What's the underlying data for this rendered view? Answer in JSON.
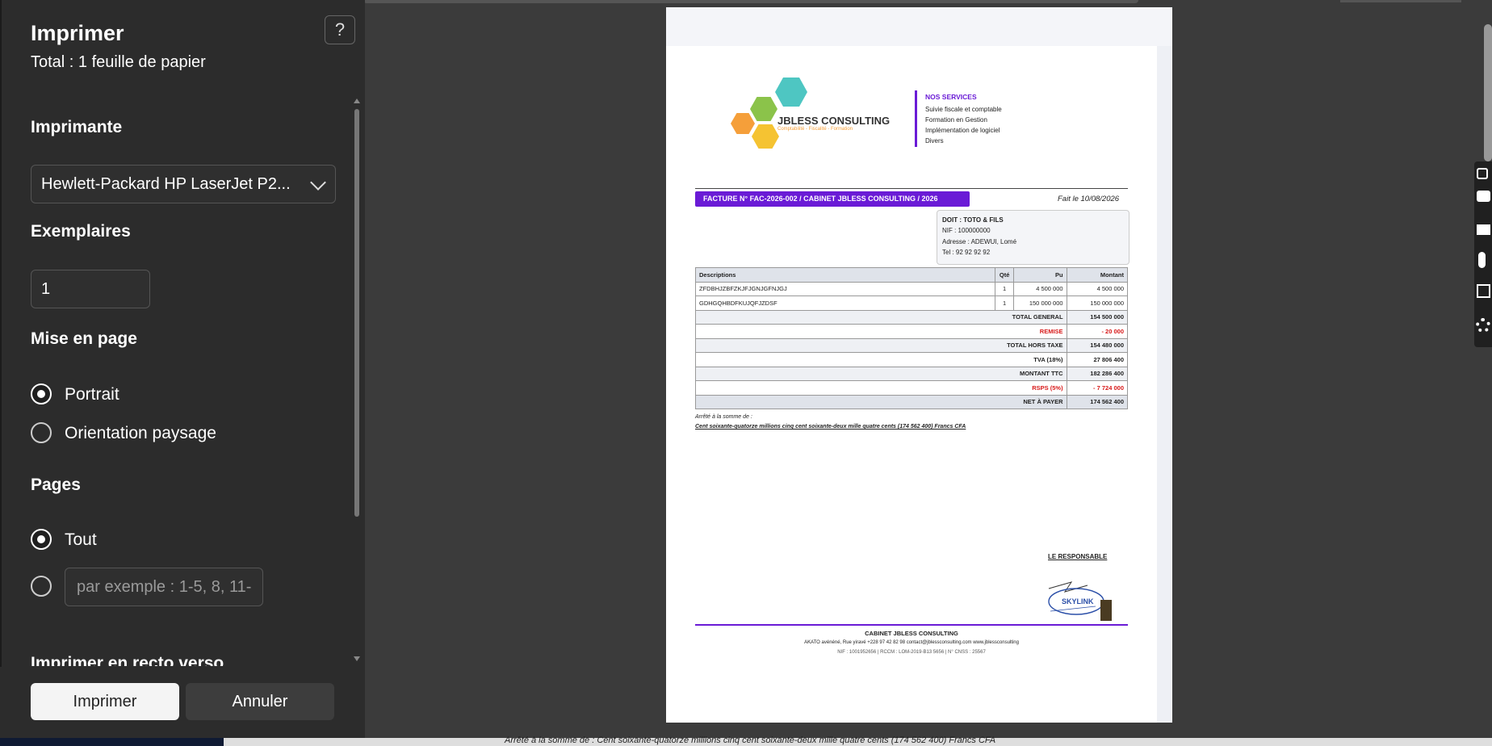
{
  "dialog": {
    "title": "Imprimer",
    "subtitle": "Total : 1 feuille de papier",
    "help_label": "?",
    "printer_label": "Imprimante",
    "printer_value": "Hewlett-Packard HP LaserJet P2...",
    "copies_label": "Exemplaires",
    "copies_value": "1",
    "layout_label": "Mise en page",
    "layout_options": [
      "Portrait",
      "Orientation paysage"
    ],
    "pages_label": "Pages",
    "pages_all": "Tout",
    "pages_placeholder": "par exemple : 1-5, 8, 11-",
    "duplex_label": "Imprimer en recto verso",
    "print_button": "Imprimer",
    "cancel_button": "Annuler"
  },
  "invoice": {
    "company_name": "JBLESS CONSULTING",
    "tagline": "Comptabilité - Fiscalité - Formation",
    "services_title": "NOS SERVICES",
    "services": [
      "Suivie fiscale et comptable",
      "Formation en Gestion",
      "Implémentation de logiciel",
      "Divers"
    ],
    "title": "FACTURE N° FAC-2026-002 / CABINET JBLESS CONSULTING / 2026",
    "date": "Fait le 10/08/2026",
    "client": [
      "DOIT : TOTO & FILS",
      "NIF : 100000000",
      "Adresse : ADEWUI, Lomé",
      "Tel : 92 92 92 92"
    ],
    "headers": [
      "Descriptions",
      "Qté",
      "Pu",
      "Montant"
    ],
    "rows": [
      [
        "ZFDBHJZBFZKJFJGNJGFNJGJ",
        "1",
        "4 500 000",
        "4 500 000"
      ],
      [
        "GDHGQHBDFKUJQFJZDSF",
        "1",
        "150 000 000",
        "150 000 000"
      ]
    ],
    "totals": [
      [
        "TOTAL GENERAL",
        "154 500 000"
      ],
      [
        "REMISE",
        "- 20 000"
      ],
      [
        "TOTAL HORS TAXE",
        "154 480 000"
      ],
      [
        "TVA (18%)",
        "27 806 400"
      ],
      [
        "MONTANT TTC",
        "182 286 400"
      ],
      [
        "RSPS (5%)",
        "- 7 724 000"
      ],
      [
        "NET À PAYER",
        "174 562 400"
      ]
    ],
    "amount_label": "Arrêté à la somme de :",
    "amount_words": "Cent soixante-quatorze millions cinq cent soixante-deux mille quatre cents (174 562 400) Francs CFA",
    "responsible": "LE RESPONSABLE",
    "stamp_text": "SKYLINK",
    "footer_name": "CABINET JBLESS CONSULTING",
    "footer_contact": "AKATO avénéné, Rue yiravé   +228 97 42 82 98   contact@jblessconsulting.com   www.jblessconsulting",
    "footer_ids": "NIF : 1001952656 | RCCM : LOM-2019-B13 5656 | N° CNSS : 25567"
  },
  "bottom_text": "Arrêté à la somme de : Cent soixante-quatorze millions cinq cent soixante-deux mille quatre cents (174 562 400) Francs CFA"
}
